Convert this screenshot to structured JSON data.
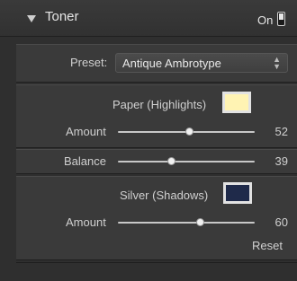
{
  "panel": {
    "title": "Toner",
    "on_label": "On",
    "preset": {
      "label": "Preset:",
      "value": "Antique Ambrotype"
    },
    "paper": {
      "label": "Paper (Highlights)",
      "color": "#fff3b3",
      "amount_label": "Amount",
      "amount": 52
    },
    "balance": {
      "label": "Balance",
      "value": 39
    },
    "silver": {
      "label": "Silver (Shadows)",
      "color": "#1f2a4a",
      "amount_label": "Amount",
      "amount": 60
    },
    "reset_label": "Reset"
  }
}
